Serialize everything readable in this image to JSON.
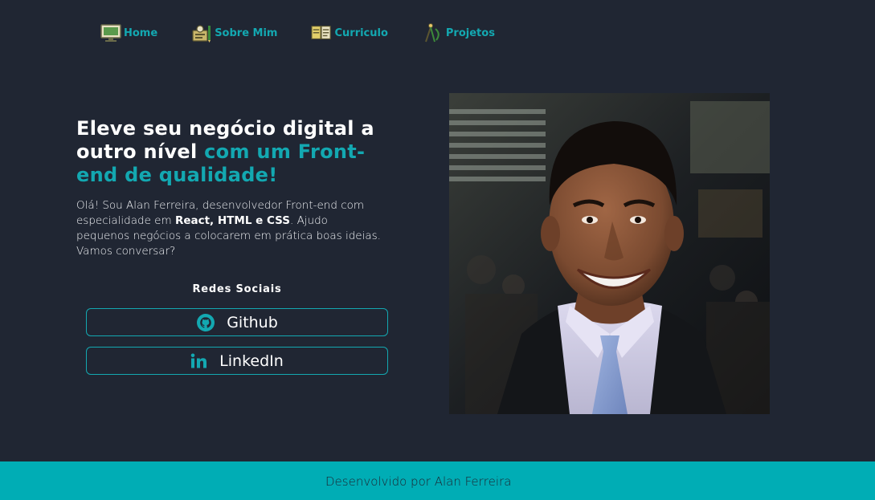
{
  "nav": {
    "items": [
      {
        "label": "Home",
        "icon": "monitor-icon"
      },
      {
        "label": "Sobre Mim",
        "icon": "id-card-icon"
      },
      {
        "label": "Curriculo",
        "icon": "document-icon"
      },
      {
        "label": "Projetos",
        "icon": "compass-icon"
      }
    ]
  },
  "hero": {
    "title_part1": "Eleve seu negócio digital a outro nível",
    "title_accent": "com um Front-end de qualidade!",
    "desc_part1": "Olá! Sou Alan Ferreira, desenvolvedor Front-end com especialidade em",
    "desc_strong": "React, HTML e CSS",
    "desc_part2": ". Ajudo pequenos negócios a colocarem em prática boas ideias. Vamos conversar?"
  },
  "social": {
    "title": "Redes Sociais",
    "github_label": "Github",
    "linkedin_label": "LinkedIn"
  },
  "footer": {
    "text": "Desenvolvido por Alan Ferreira"
  },
  "colors": {
    "background": "#202633",
    "accent": "#13a8b1",
    "footer_bg": "#00adb5"
  }
}
